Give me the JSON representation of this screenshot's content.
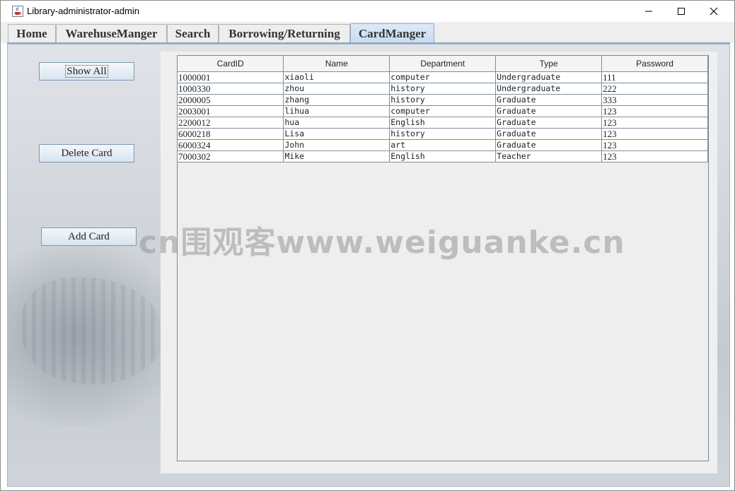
{
  "window": {
    "title": "Library-administrator-admin"
  },
  "tabs": [
    {
      "label": "Home"
    },
    {
      "label": "WarehuseManger"
    },
    {
      "label": "Search"
    },
    {
      "label": "Borrowing/Returning"
    },
    {
      "label": "CardManger",
      "selected": true
    }
  ],
  "sidebar": {
    "show_all_label": "Show All",
    "delete_card_label": "Delete Card",
    "add_card_label": "Add Card"
  },
  "table": {
    "columns": [
      "CardID",
      "Name",
      "Department",
      "Type",
      "Password"
    ],
    "rows": [
      [
        "1000001",
        "xiaoli",
        "computer",
        "Undergraduate",
        "111"
      ],
      [
        "1000330",
        "zhou",
        "history",
        "Undergraduate",
        "222"
      ],
      [
        "2000005",
        "zhang",
        "history",
        "Graduate",
        "333"
      ],
      [
        "2003001",
        "lihua",
        "computer",
        "Graduate",
        "123"
      ],
      [
        "2200012",
        "hua",
        "English",
        "Graduate",
        "123"
      ],
      [
        "6000218",
        "Lisa",
        "history",
        "Graduate",
        "123"
      ],
      [
        "6000324",
        "John",
        "art",
        "Graduate",
        "123"
      ],
      [
        "7000302",
        "Mike",
        "English",
        "Teacher",
        "123"
      ]
    ]
  },
  "watermark": "cn围观客www.weiguanke.cn",
  "colors": {
    "selected_tab": "#c7dcf1",
    "border": "#8fa9c7"
  },
  "icons": {
    "app": "java-cup-icon",
    "min": "minimize-icon",
    "max": "maximize-icon",
    "close": "close-icon"
  }
}
